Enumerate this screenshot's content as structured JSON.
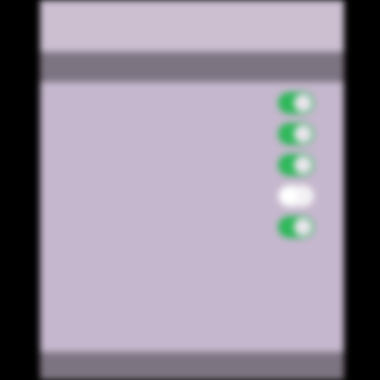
{
  "nav": {
    "back_label": "",
    "title": ""
  },
  "section": {
    "label": ""
  },
  "settings": [
    {
      "label": "",
      "enabled": true
    },
    {
      "label": "",
      "enabled": true
    },
    {
      "label": "",
      "enabled": true
    },
    {
      "label": "",
      "enabled": false
    },
    {
      "label": "",
      "enabled": true
    }
  ],
  "colors": {
    "accent": "#e2584f",
    "toggle_on": "#2fb85a",
    "toggle_off": "#f3f1f4",
    "background": "#c5b7cd",
    "bar": "#7d7482"
  }
}
